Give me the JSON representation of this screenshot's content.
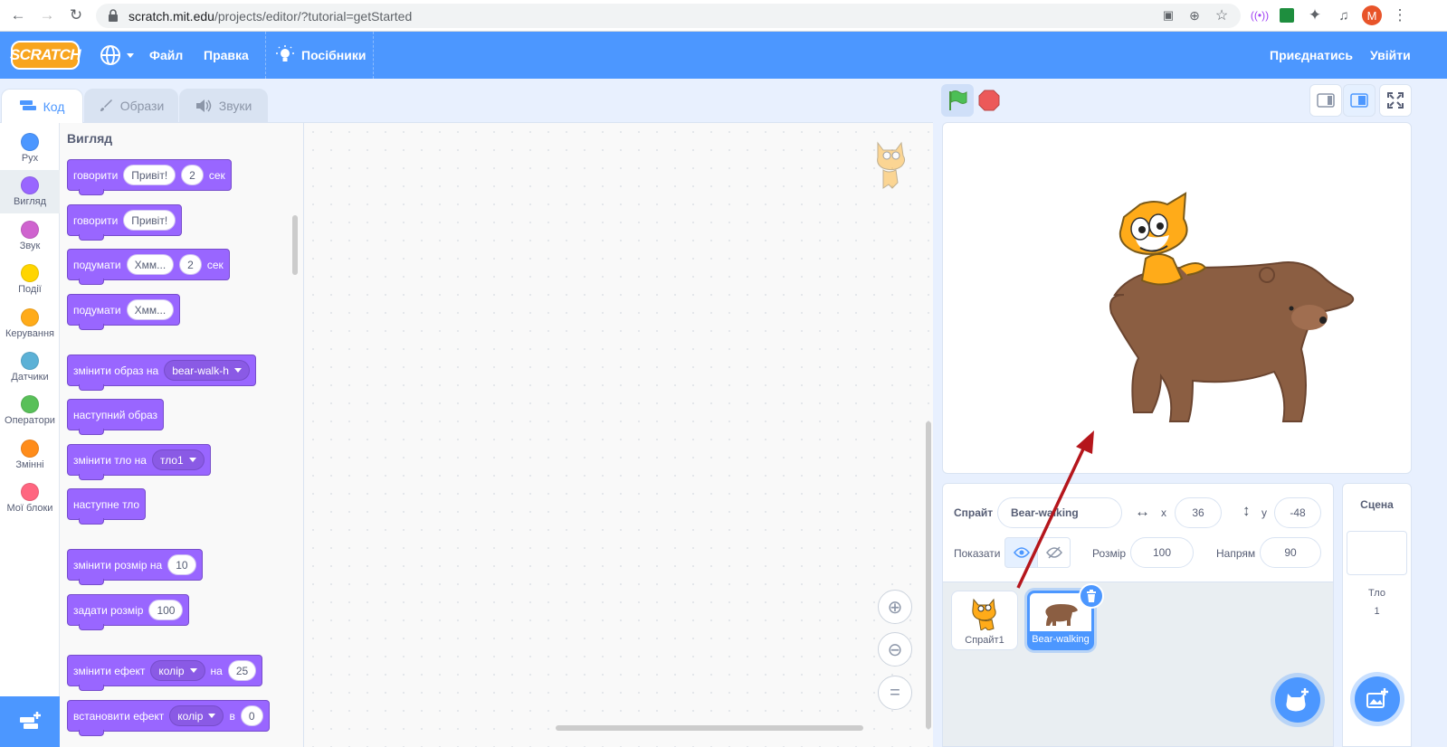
{
  "browser": {
    "url_host": "scratch.mit.edu",
    "url_path": "/projects/editor/?tutorial=getStarted",
    "profile_initial": "M"
  },
  "menubar": {
    "logo": "SCRATCH",
    "file": "Файл",
    "edit": "Правка",
    "tutorials": "Посібники",
    "join": "Приєднатись",
    "signin": "Увійти"
  },
  "tabs": {
    "code": "Код",
    "costumes": "Образи",
    "sounds": "Звуки"
  },
  "categories": [
    {
      "label": "Рух",
      "color": "#4c97ff"
    },
    {
      "label": "Вигляд",
      "color": "#9966ff"
    },
    {
      "label": "Звук",
      "color": "#cf63cf"
    },
    {
      "label": "Події",
      "color": "#ffd500"
    },
    {
      "label": "Керування",
      "color": "#ffab19"
    },
    {
      "label": "Датчики",
      "color": "#5cb1d6"
    },
    {
      "label": "Оператори",
      "color": "#59c059"
    },
    {
      "label": "Змінні",
      "color": "#ff8c1a"
    },
    {
      "label": "Мої блоки",
      "color": "#ff6680"
    }
  ],
  "palette": {
    "title": "Вигляд",
    "blocks": {
      "say_for": {
        "text": "говорити",
        "msg": "Привіт!",
        "secs": "2",
        "unit": "сек"
      },
      "say": {
        "text": "говорити",
        "msg": "Привіт!"
      },
      "think_for": {
        "text": "подумати",
        "msg": "Хмм...",
        "secs": "2",
        "unit": "сек"
      },
      "think": {
        "text": "подумати",
        "msg": "Хмм..."
      },
      "switch_costume": {
        "text": "змінити образ на",
        "value": "bear-walk-h"
      },
      "next_costume": {
        "text": "наступний образ"
      },
      "switch_backdrop": {
        "text": "змінити тло на",
        "value": "тло1"
      },
      "next_backdrop": {
        "text": "наступне тло"
      },
      "change_size": {
        "text": "змінити розмір на",
        "value": "10"
      },
      "set_size": {
        "text": "задати розмір",
        "value": "100"
      },
      "change_effect": {
        "text": "змінити ефект",
        "effect": "колір",
        "by": "на",
        "value": "25"
      },
      "set_effect": {
        "text": "встановити ефект",
        "effect": "колір",
        "to": "в",
        "value": "0"
      }
    }
  },
  "sprite_info": {
    "sprite_label": "Спрайт",
    "sprite_name": "Bear-walking",
    "x_label": "x",
    "x": "36",
    "y_label": "y",
    "y": "-48",
    "show_label": "Показати",
    "size_label": "Розмір",
    "size": "100",
    "direction_label": "Напрям",
    "direction": "90"
  },
  "sprites": [
    {
      "name": "Спрайт1"
    },
    {
      "name": "Bear-walking"
    }
  ],
  "stage_panel": {
    "title": "Сцена",
    "backdrops_label": "Тло",
    "backdrops_count": "1"
  },
  "colors": {
    "accent": "#4c97ff",
    "looks": "#9966ff",
    "arrow": "#b5161c"
  }
}
